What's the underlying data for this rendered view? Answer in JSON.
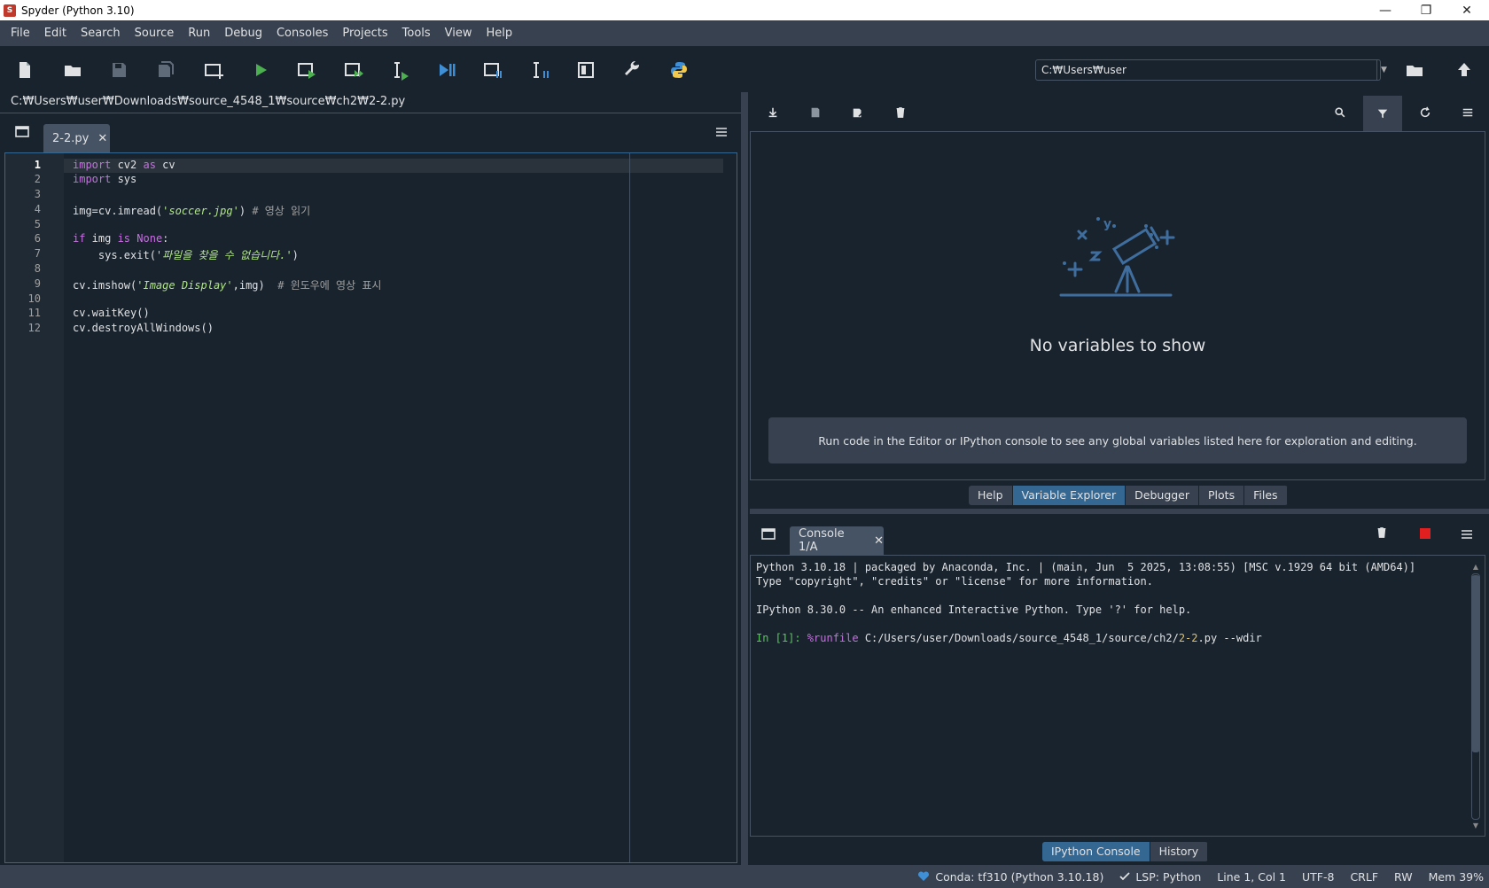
{
  "window": {
    "title": "Spyder (Python 3.10)",
    "minimize": "—",
    "maximize": "❐",
    "close": "✕"
  },
  "menu": [
    "File",
    "Edit",
    "Search",
    "Source",
    "Run",
    "Debug",
    "Consoles",
    "Projects",
    "Tools",
    "View",
    "Help"
  ],
  "toolbar": {
    "working_dir": "C:₩Users₩user"
  },
  "editor": {
    "file_path": "C:₩Users₩user₩Downloads₩source_4548_1₩source₩ch2₩2-2.py",
    "tab_label": "2-2.py",
    "tab_close": "✕",
    "line_numbers": [
      "1",
      "2",
      "3",
      "4",
      "5",
      "6",
      "7",
      "8",
      "9",
      "10",
      "11",
      "12"
    ],
    "code": {
      "l1_kw": "import",
      "l1_rest": " cv2 ",
      "l1_kw2": "as",
      "l1_rest2": " cv",
      "l2_kw": "import",
      "l2_rest": " sys",
      "l4_a": "img=cv.imread(",
      "l4_str": "'soccer.jpg'",
      "l4_b": ") ",
      "l4_cmt": "# 영상 읽기",
      "l6_kw": "if",
      "l6_a": " img ",
      "l6_kw2": "is",
      "l6_b": " ",
      "l6_none": "None",
      "l6_c": ":",
      "l7_a": "    sys.exit(",
      "l7_str": "'파일을 찾을 수 없습니다.'",
      "l7_b": ")",
      "l9_a": "cv.imshow(",
      "l9_str": "'Image Display'",
      "l9_b": ",img)  ",
      "l9_cmt": "# 윈도우에 영상 표시",
      "l11": "cv.waitKey()",
      "l12": "cv.destroyAllWindows()"
    }
  },
  "variable_explorer": {
    "empty_title": "No variables to show",
    "hint": "Run code in the Editor or IPython console to see any global variables listed here for exploration and editing."
  },
  "upper_tabs": [
    "Help",
    "Variable Explorer",
    "Debugger",
    "Plots",
    "Files"
  ],
  "console": {
    "tab_label": "Console 1/A",
    "tab_close": "✕",
    "line1": "Python 3.10.18 | packaged by Anaconda, Inc. | (main, Jun  5 2025, 13:08:55) [MSC v.1929 64 bit (AMD64)]",
    "line2": "Type \"copyright\", \"credits\" or \"license\" for more information.",
    "line3": "IPython 8.30.0 -- An enhanced Interactive Python. Type '?' for help.",
    "prompt": "In [1]: ",
    "magic": "%runfile",
    "cmd_a": " C:/Users/user/Downloads/source_4548_1/source/ch2/",
    "cmd_num": "2-2",
    "cmd_b": ".py --wdir"
  },
  "lower_tabs": [
    "IPython Console",
    "History"
  ],
  "status": {
    "conda": "Conda: tf310 (Python 3.10.18)",
    "lsp": "LSP: Python",
    "position": "Line 1, Col 1",
    "encoding": "UTF-8",
    "eol": "CRLF",
    "perm": "RW",
    "mem": "Mem 39%"
  },
  "colors": {
    "accent": "#346792",
    "background": "#19232d",
    "panel": "#37414f",
    "icon": "#3f8fd6"
  }
}
